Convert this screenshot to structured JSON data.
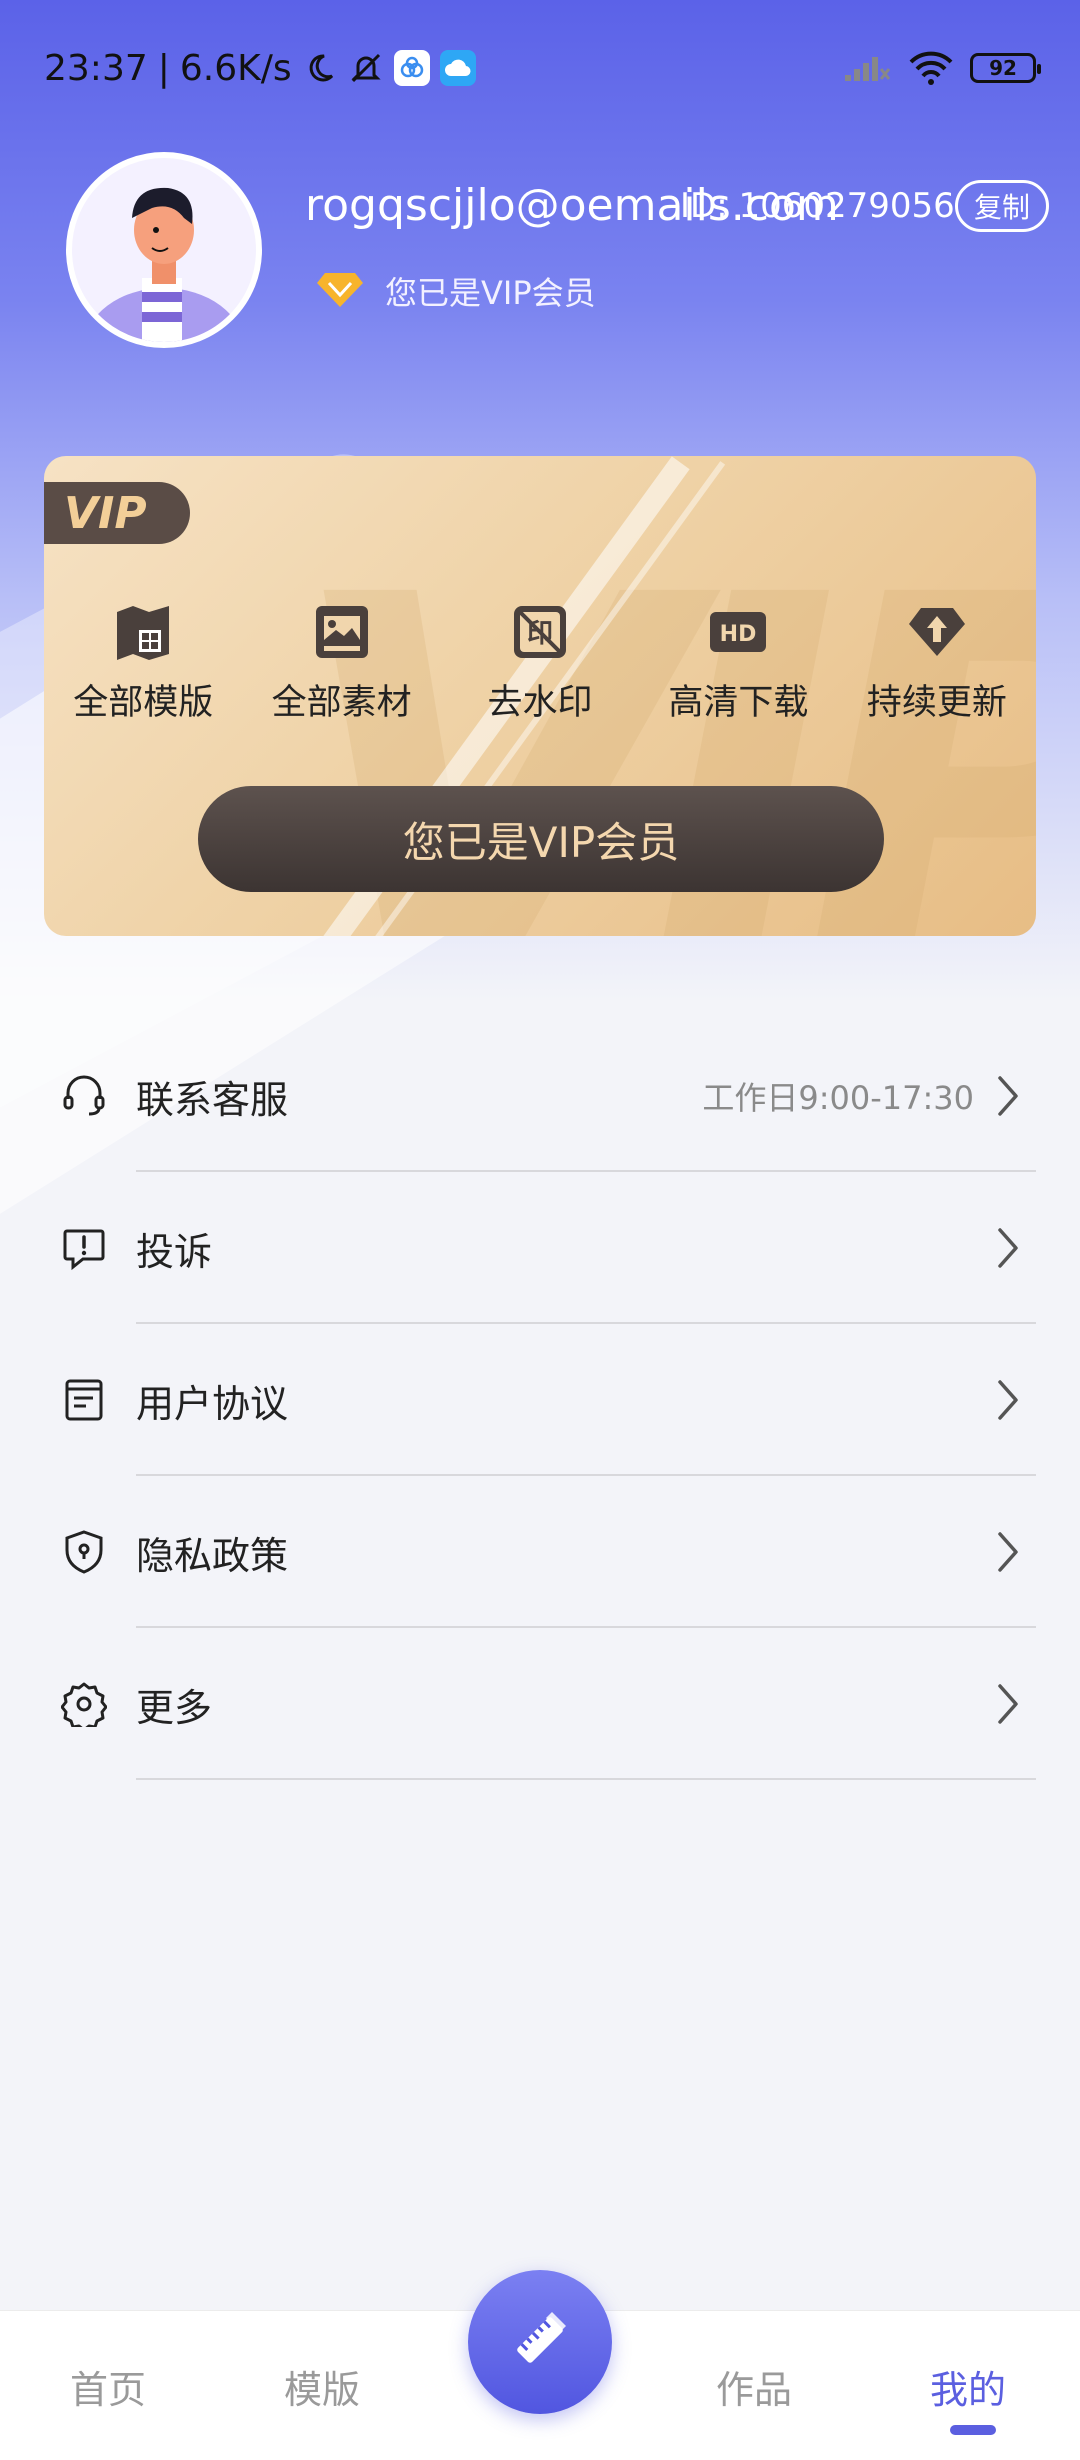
{
  "status_bar": {
    "time": "23:37",
    "separator": "|",
    "net_speed": "6.6K/s",
    "battery": "92"
  },
  "profile": {
    "email": "rogqscjjlo@oemails.com",
    "id_text": "ID: 1060279056",
    "copy_label": "复制",
    "vip_status": "您已是VIP会员"
  },
  "vip_card": {
    "tag": "VIP",
    "benefits": [
      {
        "label": "全部模版",
        "icon": "template-icon"
      },
      {
        "label": "全部素材",
        "icon": "image-icon"
      },
      {
        "label": "去水印",
        "icon": "watermark-icon"
      },
      {
        "label": "高清下载",
        "icon": "hd-icon"
      },
      {
        "label": "持续更新",
        "icon": "update-icon"
      }
    ],
    "hd_badge": "HD",
    "watermark_glyph": "印",
    "button_label": "您已是VIP会员"
  },
  "menu": [
    {
      "label": "联系客服",
      "extra": "工作日9:00-17:30",
      "icon": "headset-icon"
    },
    {
      "label": "投诉",
      "icon": "complaint-icon"
    },
    {
      "label": "用户协议",
      "icon": "document-icon"
    },
    {
      "label": "隐私政策",
      "icon": "shield-icon"
    },
    {
      "label": "更多",
      "icon": "gear-icon"
    }
  ],
  "bottom_nav": {
    "items": [
      {
        "label": "首页"
      },
      {
        "label": "模版"
      },
      {
        "label": "作品"
      },
      {
        "label": "我的"
      }
    ],
    "active": "我的"
  },
  "colors": {
    "primary": "#5b5fe0",
    "vip_gold": "#efd2a6",
    "vip_dark": "#4a403c"
  }
}
